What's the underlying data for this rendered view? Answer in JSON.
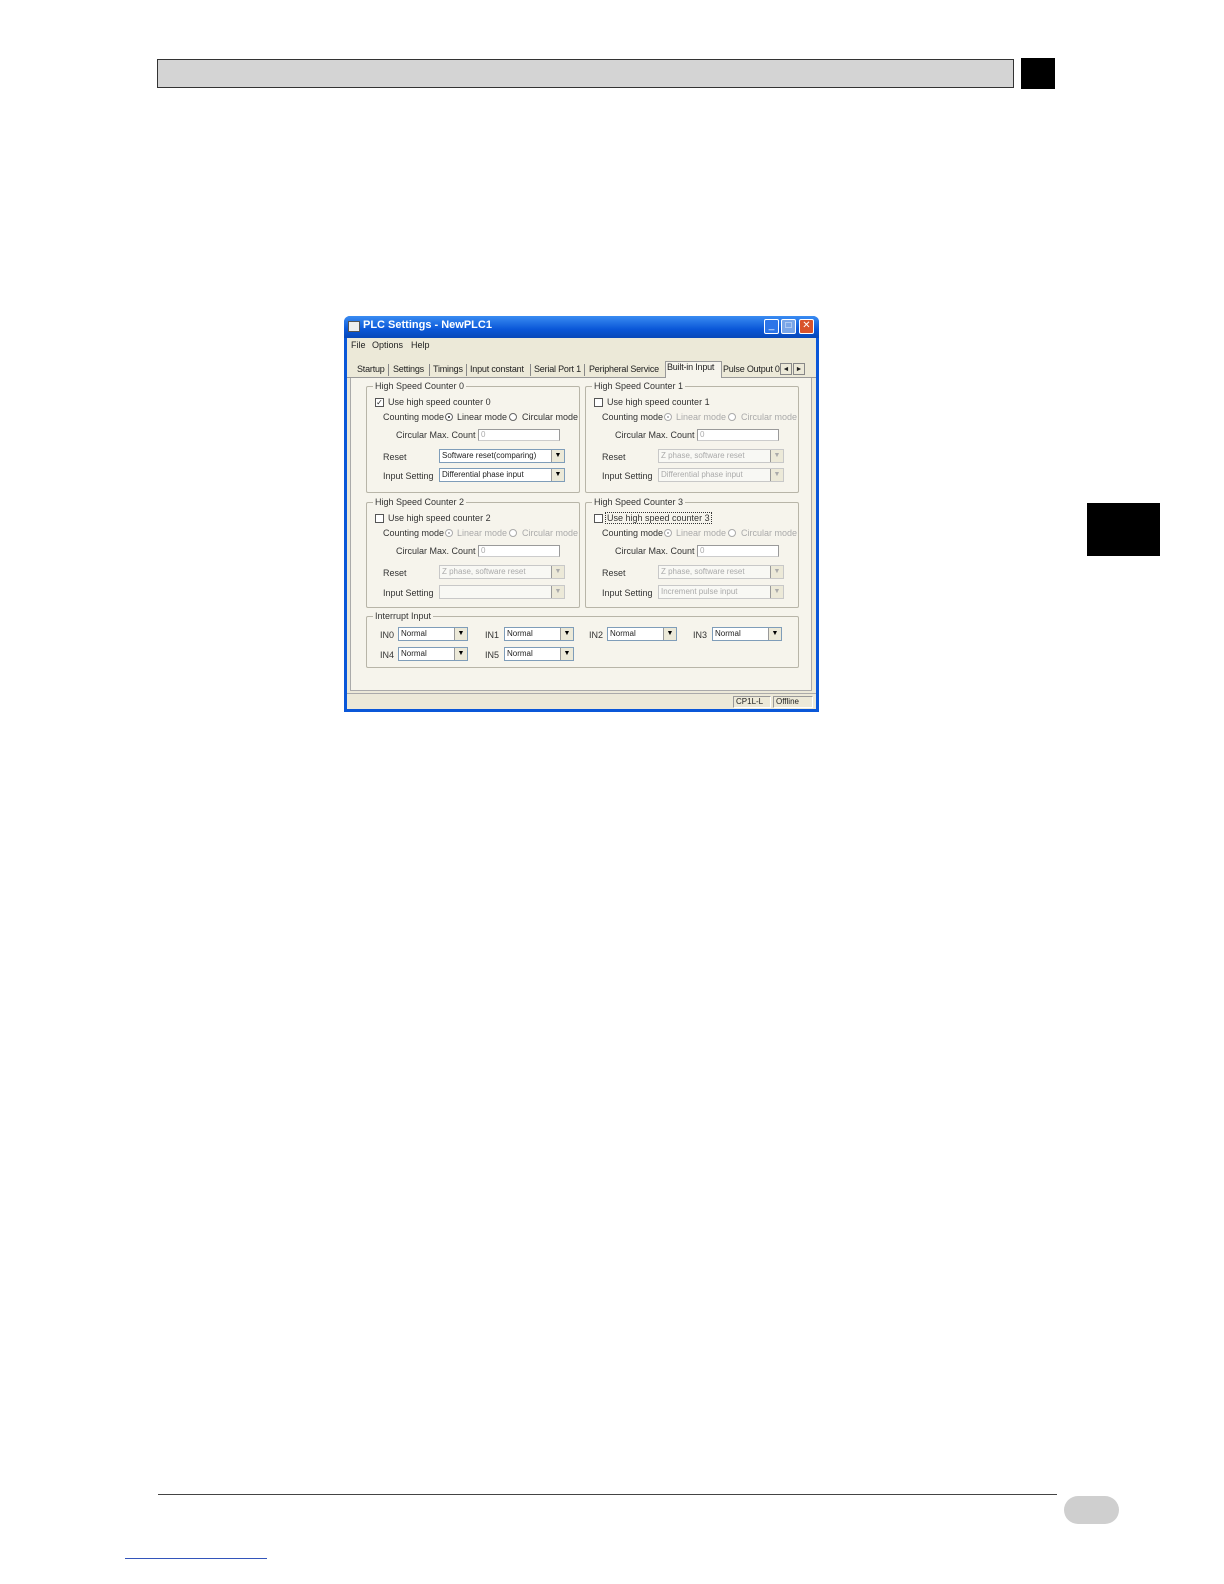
{
  "window": {
    "title": "PLC Settings - NewPLC1",
    "menus": [
      "File",
      "Options",
      "Help"
    ],
    "tabs": [
      "Startup",
      "Settings",
      "Timings",
      "Input constant",
      "Serial Port 1",
      "Peripheral Service",
      "Built-in Input",
      "Pulse Output 0"
    ],
    "active_tab": "Built-in Input",
    "controls": {
      "minimize": "_",
      "maximize": "□",
      "close": "✕",
      "scroll_left": "◄",
      "scroll_right": "►"
    }
  },
  "counters": [
    {
      "title": "High Speed Counter 0",
      "use_label": "Use high speed counter 0",
      "use_checked": true,
      "counting_mode_label": "Counting mode",
      "linear_label": "Linear mode",
      "circular_label": "Circular mode",
      "circular_max_label": "Circular Max. Count",
      "circular_max_value": "0",
      "reset_label": "Reset",
      "reset_value": "Software reset(comparing)",
      "input_setting_label": "Input Setting",
      "input_setting_value": "Differential phase input"
    },
    {
      "title": "High Speed Counter 1",
      "use_label": "Use high speed counter 1",
      "use_checked": false,
      "counting_mode_label": "Counting mode",
      "linear_label": "Linear mode",
      "circular_label": "Circular mode",
      "circular_max_label": "Circular Max. Count",
      "circular_max_value": "0",
      "reset_label": "Reset",
      "reset_value": "Z phase, software reset",
      "input_setting_label": "Input Setting",
      "input_setting_value": "Differential phase input"
    },
    {
      "title": "High Speed Counter 2",
      "use_label": "Use high speed counter 2",
      "use_checked": false,
      "counting_mode_label": "Counting mode",
      "linear_label": "Linear mode",
      "circular_label": "Circular mode",
      "circular_max_label": "Circular Max. Count",
      "circular_max_value": "0",
      "reset_label": "Reset",
      "reset_value": "Z phase, software reset",
      "input_setting_label": "Input Setting",
      "input_setting_value": ""
    },
    {
      "title": "High Speed Counter 3",
      "use_label": "Use high speed counter 3",
      "use_checked": false,
      "counting_mode_label": "Counting mode",
      "linear_label": "Linear mode",
      "circular_label": "Circular mode",
      "circular_max_label": "Circular Max. Count",
      "circular_max_value": "0",
      "reset_label": "Reset",
      "reset_value": "Z phase, software reset",
      "input_setting_label": "Input Setting",
      "input_setting_value": "Increment pulse input"
    }
  ],
  "interrupt": {
    "title": "Interrupt Input",
    "inputs": [
      {
        "label": "IN0",
        "value": "Normal"
      },
      {
        "label": "IN1",
        "value": "Normal"
      },
      {
        "label": "IN2",
        "value": "Normal"
      },
      {
        "label": "IN3",
        "value": "Normal"
      },
      {
        "label": "IN4",
        "value": "Normal"
      },
      {
        "label": "IN5",
        "value": "Normal"
      }
    ]
  },
  "status": {
    "model": "CP1L-L",
    "mode": "Offline"
  }
}
